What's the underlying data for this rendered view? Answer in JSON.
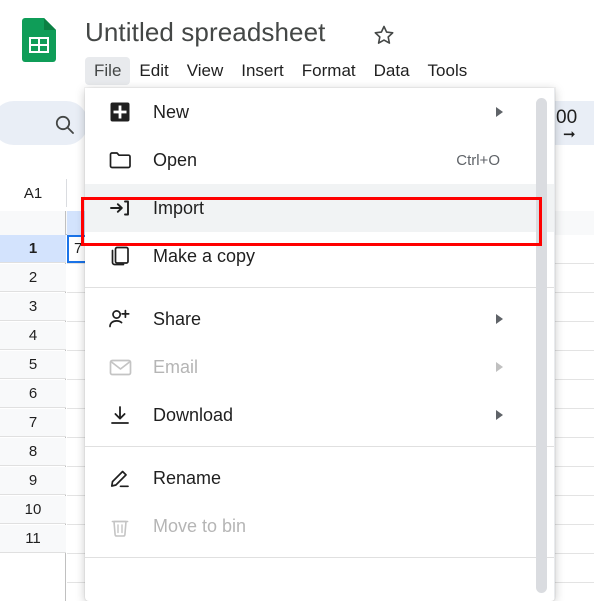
{
  "app": {
    "name": "Google Sheets",
    "logo_icon": "sheets-logo-icon"
  },
  "header": {
    "doc_title": "Untitled spreadsheet",
    "star_icon": "star-outline-icon",
    "menus": [
      {
        "label": "File",
        "active": true
      },
      {
        "label": "Edit",
        "active": false
      },
      {
        "label": "View",
        "active": false
      },
      {
        "label": "Insert",
        "active": false
      },
      {
        "label": "Format",
        "active": false
      },
      {
        "label": "Data",
        "active": false
      },
      {
        "label": "Tools",
        "active": false
      }
    ]
  },
  "toolbar": {
    "search_icon": "search-icon",
    "right_fragment_text": "00",
    "right_fragment_arrow": "arrow-right-icon"
  },
  "formula_bar": {
    "name_box_value": "A1"
  },
  "grid": {
    "selected_cell": "A1",
    "selected_cell_text": "7",
    "row_headers": [
      "1",
      "2",
      "3",
      "4",
      "5",
      "6",
      "7",
      "8",
      "9",
      "10",
      "11"
    ],
    "selected_row": "1"
  },
  "file_menu": {
    "open": true,
    "items": [
      {
        "id": "new",
        "label": "New",
        "icon": "new-file-icon",
        "accel": "",
        "submenu": true,
        "disabled": false,
        "hover": false,
        "sep_after": false
      },
      {
        "id": "open",
        "label": "Open",
        "icon": "folder-icon",
        "accel": "Ctrl+O",
        "submenu": false,
        "disabled": false,
        "hover": false,
        "sep_after": false
      },
      {
        "id": "import",
        "label": "Import",
        "icon": "import-icon",
        "accel": "",
        "submenu": false,
        "disabled": false,
        "hover": true,
        "sep_after": false
      },
      {
        "id": "make-a-copy",
        "label": "Make a copy",
        "icon": "copy-icon",
        "accel": "",
        "submenu": false,
        "disabled": false,
        "hover": false,
        "sep_after": true
      },
      {
        "id": "share",
        "label": "Share",
        "icon": "person-add-icon",
        "accel": "",
        "submenu": true,
        "disabled": false,
        "hover": false,
        "sep_after": false
      },
      {
        "id": "email",
        "label": "Email",
        "icon": "envelope-icon",
        "accel": "",
        "submenu": true,
        "disabled": true,
        "hover": false,
        "sep_after": false
      },
      {
        "id": "download",
        "label": "Download",
        "icon": "download-icon",
        "accel": "",
        "submenu": true,
        "disabled": false,
        "hover": false,
        "sep_after": true
      },
      {
        "id": "rename",
        "label": "Rename",
        "icon": "pencil-icon",
        "accel": "",
        "submenu": false,
        "disabled": false,
        "hover": false,
        "sep_after": false
      },
      {
        "id": "move-to-bin",
        "label": "Move to bin",
        "icon": "trash-icon",
        "accel": "",
        "submenu": false,
        "disabled": true,
        "hover": false,
        "sep_after": true
      }
    ]
  },
  "annotation": {
    "target": "import",
    "color": "#ff0000"
  },
  "colors": {
    "brand_green": "#0f9d58",
    "selection_blue": "#1a73e8",
    "header_blue": "#d3e3fd",
    "hover_grey": "#f1f3f4",
    "annotation_red": "#ff0000"
  }
}
